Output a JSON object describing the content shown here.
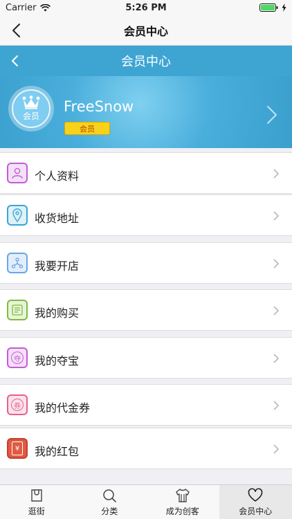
{
  "status_bar": {
    "carrier": "Carrier",
    "time": "5:26 PM"
  },
  "nav_bar": {
    "title": "会员中心"
  },
  "web_header": {
    "title": "会员中心"
  },
  "profile": {
    "avatar_text": "会员",
    "username": "FreeSnow",
    "badge": "会员"
  },
  "menu": {
    "items": [
      {
        "label": "个人资料",
        "icon": "person-icon",
        "color": "#c65ad8"
      },
      {
        "label": "收货地址",
        "icon": "location-pin-icon",
        "color": "#3aa6d2"
      },
      {
        "label": "我要开店",
        "icon": "store-network-icon",
        "color": "#6aa5e8"
      },
      {
        "label": "我的购买",
        "icon": "purchase-list-icon",
        "color": "#7fbb3d"
      },
      {
        "label": "我的夺宝",
        "icon": "treasure-icon",
        "color": "#c65ad8",
        "glyph": "夺"
      },
      {
        "label": "我的代金券",
        "icon": "voucher-icon",
        "color": "#e6608f",
        "glyph": "券"
      },
      {
        "label": "我的红包",
        "icon": "red-envelope-icon",
        "color": "#c4402c",
        "glyph": "¥"
      }
    ]
  },
  "tab_bar": {
    "tabs": [
      {
        "label": "逛街",
        "icon": "bag-icon"
      },
      {
        "label": "分类",
        "icon": "search-icon"
      },
      {
        "label": "成为创客",
        "icon": "shirt-icon"
      },
      {
        "label": "会员中心",
        "icon": "heart-icon",
        "active": true
      }
    ]
  }
}
